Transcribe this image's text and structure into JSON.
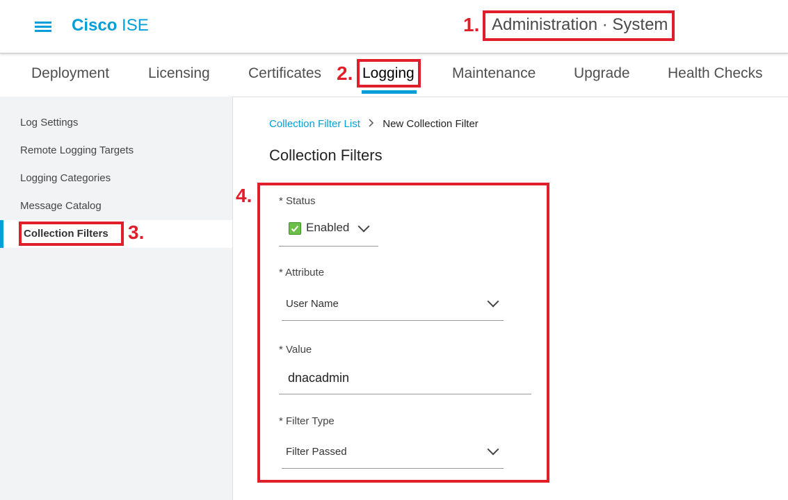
{
  "header": {
    "brand_bold": "Cisco",
    "brand_product": "ISE",
    "title": "Administration · System"
  },
  "callouts": [
    "1.",
    "2.",
    "3.",
    "4."
  ],
  "tabs": [
    {
      "label": "Deployment"
    },
    {
      "label": "Licensing"
    },
    {
      "label": "Certificates"
    },
    {
      "label": "Logging",
      "active": true
    },
    {
      "label": "Maintenance"
    },
    {
      "label": "Upgrade"
    },
    {
      "label": "Health Checks"
    }
  ],
  "sidebar": {
    "items": [
      {
        "label": "Log Settings"
      },
      {
        "label": "Remote Logging Targets"
      },
      {
        "label": "Logging Categories"
      },
      {
        "label": "Message Catalog"
      },
      {
        "label": "Collection Filters",
        "active": true
      }
    ]
  },
  "breadcrumb": {
    "link": "Collection Filter List",
    "current": "New Collection Filter"
  },
  "page_title": "Collection Filters",
  "form": {
    "status": {
      "label": "* Status",
      "value": "Enabled"
    },
    "attribute": {
      "label": "* Attribute",
      "value": "User Name"
    },
    "value": {
      "label": "* Value",
      "value": "dnacadmin"
    },
    "filter_type": {
      "label": "* Filter Type",
      "value": "Filter Passed"
    }
  },
  "colors": {
    "accent": "#049fd9",
    "annotation": "#e01f2a",
    "enabled_check": "#6cc04a"
  }
}
